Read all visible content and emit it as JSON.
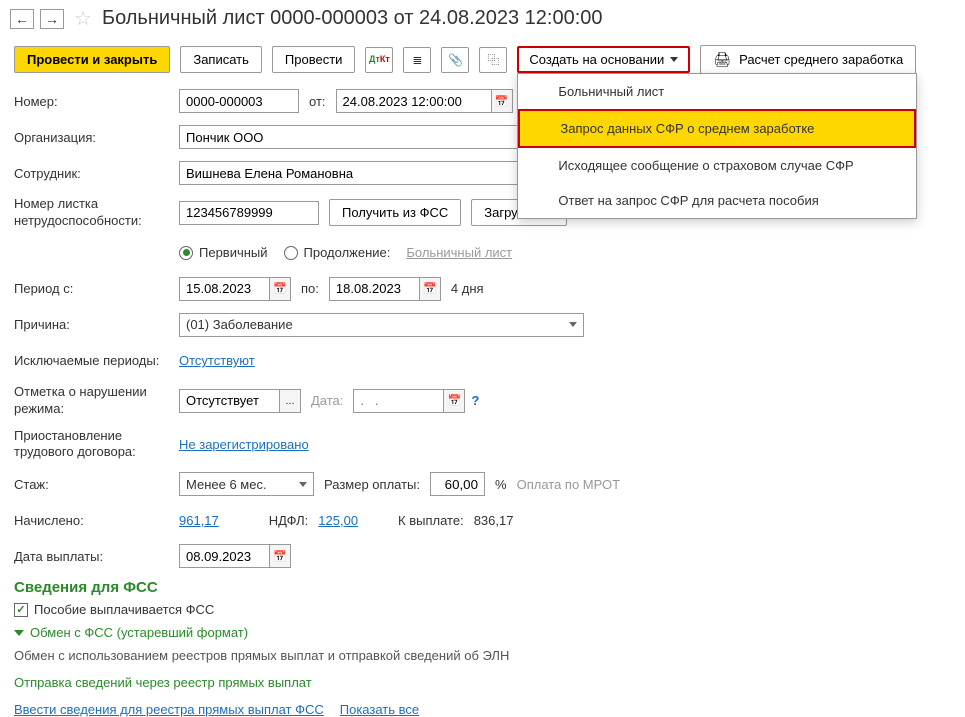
{
  "header": {
    "title": "Больничный лист 0000-000003 от 24.08.2023 12:00:00"
  },
  "toolbar": {
    "submit_close": "Провести и закрыть",
    "save": "Записать",
    "submit": "Провести",
    "create_based": "Создать на основании",
    "calc_avg": "Расчет среднего заработка"
  },
  "dropdown": {
    "items": [
      "Больничный лист",
      "Запрос данных СФР о среднем заработке",
      "Исходящее сообщение о страховом случае СФР",
      "Ответ на запрос СФР для расчета пособия"
    ]
  },
  "fields": {
    "number_label": "Номер:",
    "number": "0000-000003",
    "from_label": "от:",
    "datetime": "24.08.2023 12:00:00",
    "org_label": "Организация:",
    "org": "Пончик ООО",
    "employee_label": "Сотрудник:",
    "employee": "Вишнева Елена Романовна",
    "sheet_no_label": "Номер листка нетрудоспособности:",
    "sheet_no": "123456789999",
    "get_fss": "Получить из ФСС",
    "load_file": "Загрузить и",
    "primary": "Первичный",
    "continuation": "Продолжение:",
    "cont_link": "Больничный лист",
    "period_from_label": "Период с:",
    "period_from": "15.08.2023",
    "to_label": "по:",
    "period_to": "18.08.2023",
    "days": "4 дня",
    "reason_label": "Причина:",
    "reason": "(01) Заболевание",
    "excluded_label": "Исключаемые периоды:",
    "excluded": "Отсутствуют",
    "violation_label": "Отметка о нарушении режима:",
    "violation": "Отсутствует",
    "date_label": "Дата:",
    "date_placeholder": ".   .",
    "suspension_label": "Приостановление трудового договора:",
    "suspension": "Не зарегистрировано",
    "seniority_label": "Стаж:",
    "seniority": "Менее 6 мес.",
    "pay_size_label": "Размер оплаты:",
    "pay_size": "60,00",
    "percent": "%",
    "mrot": "Оплата по МРОТ",
    "accrued_label": "Начислено:",
    "accrued": "961,17",
    "ndfl_label": "НДФЛ:",
    "ndfl": "125,00",
    "payout_label": "К выплате:",
    "payout": "836,17",
    "pay_date_label": "Дата выплаты:",
    "pay_date": "08.09.2023"
  },
  "fss": {
    "section_title": "Сведения для ФСС",
    "checkbox": "Пособие выплачивается ФСС",
    "collapsible": "Обмен с ФСС (устаревший формат)",
    "info": "Обмен с использованием реестров прямых выплат и отправкой сведений об ЭЛН",
    "send_title": "Отправка сведений через реестр прямых выплат",
    "link1": "Ввести сведения для реестра прямых выплат ФСС",
    "link2": "Показать все"
  }
}
